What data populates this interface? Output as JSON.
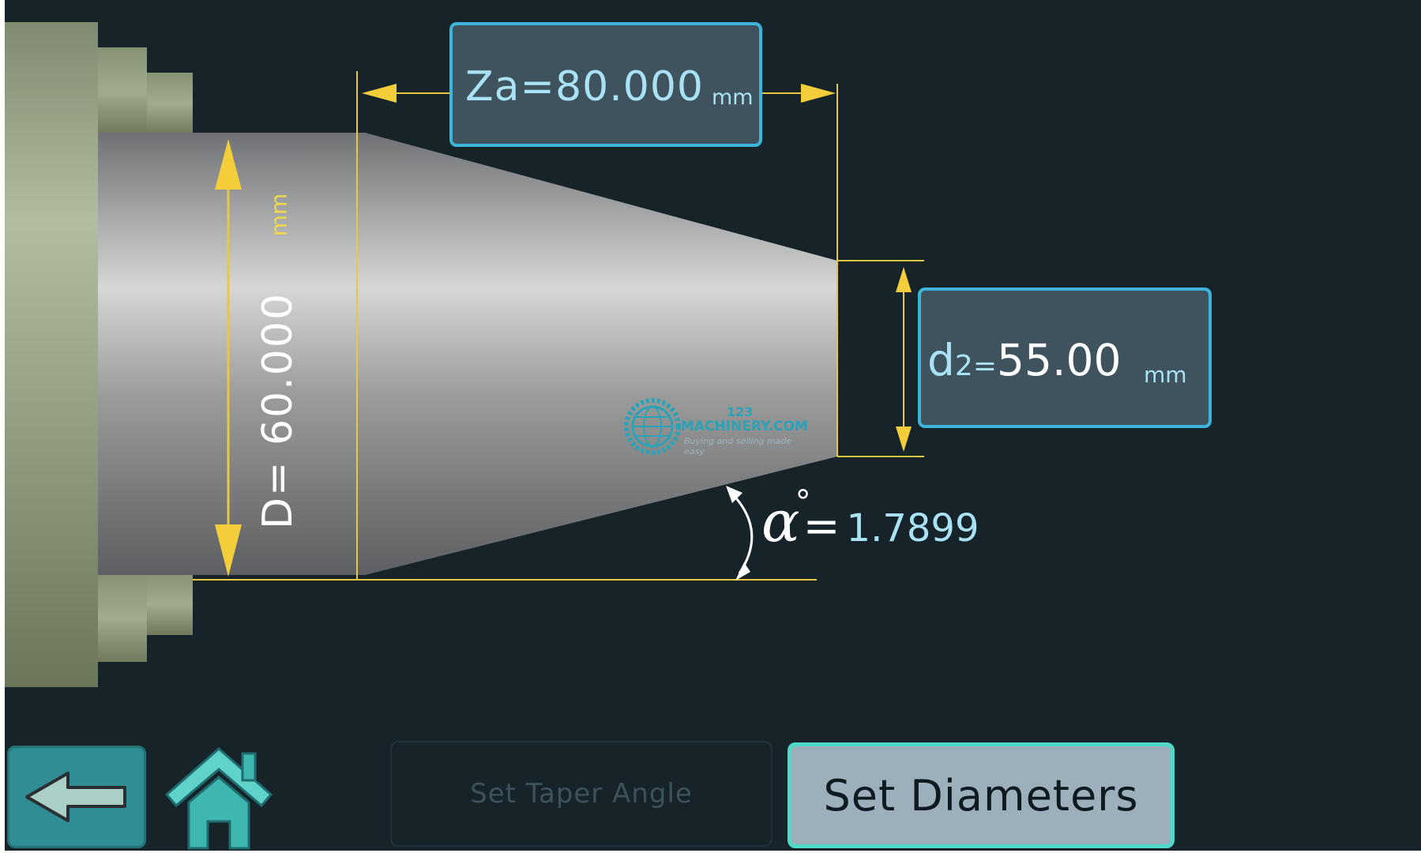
{
  "taper_length": {
    "label": "Za=80.000",
    "unit": "mm"
  },
  "small_diameter": {
    "symbol": "d",
    "subscript": "2",
    "equals": "=",
    "value": "55.00",
    "unit": "mm"
  },
  "large_diameter": {
    "label": "D= 60.000",
    "unit": "mm"
  },
  "taper_angle": {
    "symbol": "α",
    "degree": "°",
    "equals": "=",
    "value": "1.7899"
  },
  "watermark": {
    "number": "123",
    "brand": "MACHINERY.COM",
    "tagline": "Buying and selling made easy"
  },
  "buttons": {
    "set_taper_angle": "Set Taper Angle",
    "set_diameters": "Set Diameters"
  },
  "icons": {
    "back": "back-arrow-icon",
    "home": "home-icon"
  },
  "colors": {
    "background": "#16242a",
    "dimension_line": "#e8c840",
    "box_border": "#3db4d9",
    "box_fill": "#3f535e",
    "accent_button": "#4fd9c8"
  }
}
